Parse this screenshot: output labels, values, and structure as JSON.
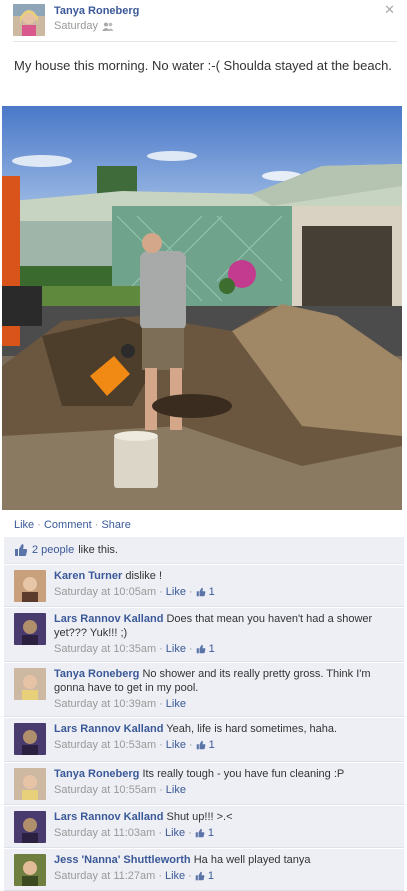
{
  "post": {
    "author": "Tanya Roneberg",
    "time": "Saturday",
    "text": "My house this morning. No water :-( Shoulda stayed at the beach."
  },
  "actions": {
    "like": "Like",
    "comment": "Comment",
    "share": "Share",
    "sep": "·"
  },
  "likes": {
    "count_label": "2 people",
    "suffix": "like this."
  },
  "comments": [
    {
      "author": "Karen Turner",
      "text": "dislike !",
      "time": "Saturday at 10:05am",
      "like": "Like",
      "likes": "1"
    },
    {
      "author": "Lars Rannov Kalland",
      "text": "Does that mean you haven't had a shower yet??? Yuk!!! ;)",
      "time": "Saturday at 10:35am",
      "like": "Like",
      "likes": "1"
    },
    {
      "author": "Tanya Roneberg",
      "text": "No shower and its really pretty gross. Think I'm gonna have to get in my pool.",
      "time": "Saturday at 10:39am",
      "like": "Like",
      "likes": ""
    },
    {
      "author": "Lars Rannov Kalland",
      "text": "Yeah, life is hard sometimes, haha.",
      "time": "Saturday at 10:53am",
      "like": "Like",
      "likes": "1"
    },
    {
      "author": "Tanya Roneberg",
      "text": "Its really tough - you have fun cleaning :P",
      "time": "Saturday at 10:55am",
      "like": "Like",
      "likes": ""
    },
    {
      "author": "Lars Rannov Kalland",
      "text": "Shut up!!! >.<",
      "time": "Saturday at 11:03am",
      "like": "Like",
      "likes": "1"
    },
    {
      "author": "Jess 'Nanna' Shuttleworth",
      "text": "Ha ha well played tanya",
      "time": "Saturday at 11:27am",
      "like": "Like",
      "likes": "1"
    }
  ],
  "colors": {
    "link": "#3b5998",
    "feedback_bg": "#edeff4",
    "muted": "#999999"
  }
}
